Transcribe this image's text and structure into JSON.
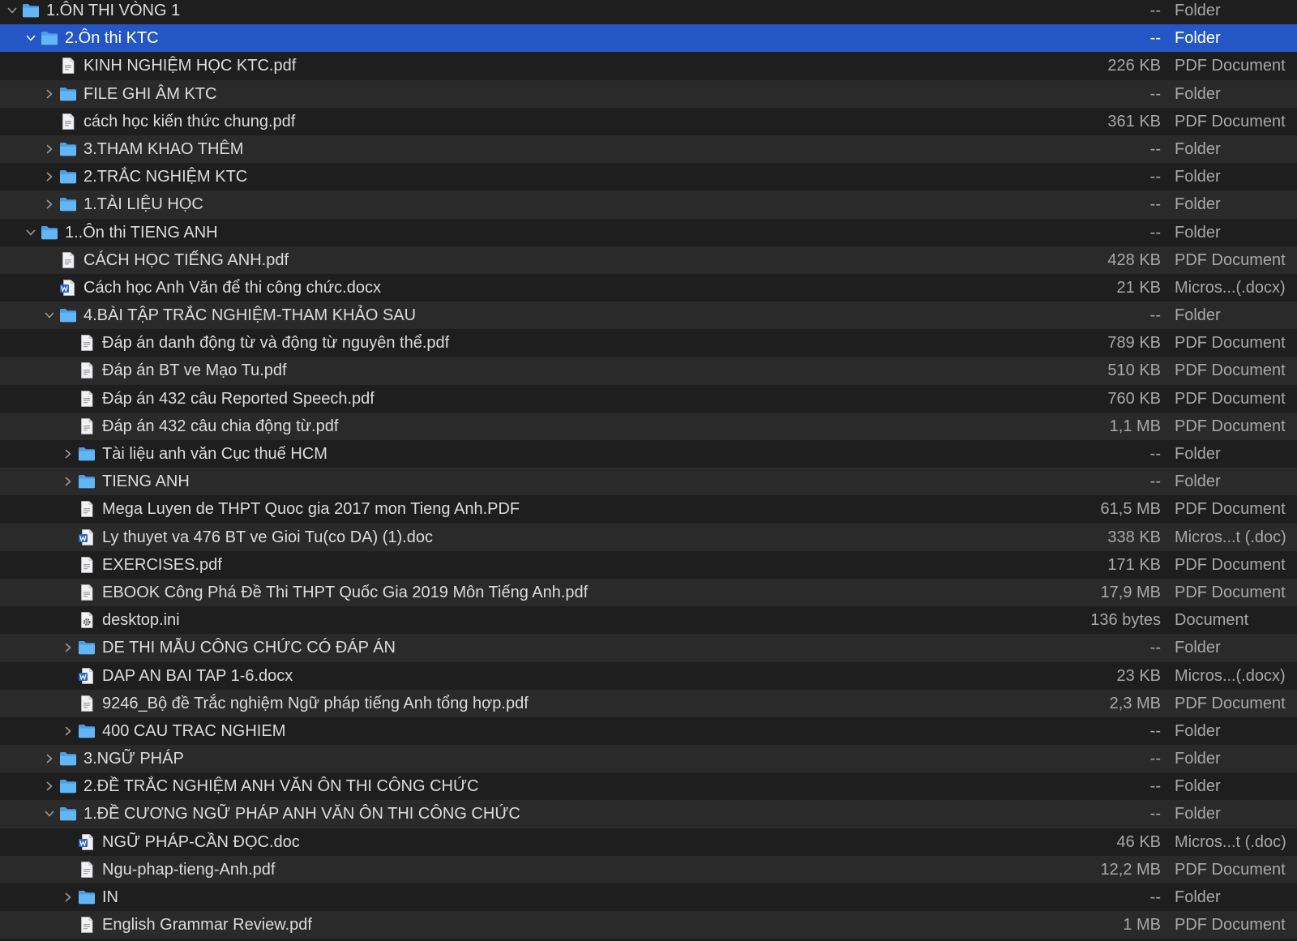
{
  "rows": [
    {
      "name": "1.ÔN THI VÒNG 1",
      "size": "--",
      "kind": "Folder",
      "depth": 0,
      "type": "folder",
      "disclosure": "expanded",
      "selected": false
    },
    {
      "name": "2.Ôn thi  KTC",
      "size": "--",
      "kind": "Folder",
      "depth": 1,
      "type": "folder",
      "disclosure": "expanded",
      "selected": true
    },
    {
      "name": "KINH NGHIỆM HỌC KTC.pdf",
      "size": "226 KB",
      "kind": "PDF Document",
      "depth": 2,
      "type": "pdf",
      "disclosure": "none",
      "selected": false
    },
    {
      "name": "FILE GHI ÂM KTC",
      "size": "--",
      "kind": "Folder",
      "depth": 2,
      "type": "folder",
      "disclosure": "collapsed",
      "selected": false
    },
    {
      "name": "cách học kiến thức chung.pdf",
      "size": "361 KB",
      "kind": "PDF Document",
      "depth": 2,
      "type": "pdf",
      "disclosure": "none",
      "selected": false
    },
    {
      "name": "3.THAM KHAO THÊM",
      "size": "--",
      "kind": "Folder",
      "depth": 2,
      "type": "folder",
      "disclosure": "collapsed",
      "selected": false
    },
    {
      "name": "2.TRẮC NGHIỆM KTC",
      "size": "--",
      "kind": "Folder",
      "depth": 2,
      "type": "folder",
      "disclosure": "collapsed",
      "selected": false
    },
    {
      "name": "1.TÀI LIỆU HỌC",
      "size": "--",
      "kind": "Folder",
      "depth": 2,
      "type": "folder",
      "disclosure": "collapsed",
      "selected": false
    },
    {
      "name": "1..Ôn thi TIENG ANH",
      "size": "--",
      "kind": "Folder",
      "depth": 1,
      "type": "folder",
      "disclosure": "expanded",
      "selected": false
    },
    {
      "name": "CÁCH HỌC TIẾNG ANH.pdf",
      "size": "428 KB",
      "kind": "PDF Document",
      "depth": 2,
      "type": "pdf",
      "disclosure": "none",
      "selected": false
    },
    {
      "name": "Cách học Anh Văn để thi công chức.docx",
      "size": "21 KB",
      "kind": "Micros...(.docx)",
      "depth": 2,
      "type": "word",
      "disclosure": "none",
      "selected": false
    },
    {
      "name": "4.BÀI TẬP TRẮC NGHIỆM-THAM KHẢO  SAU",
      "size": "--",
      "kind": "Folder",
      "depth": 2,
      "type": "folder",
      "disclosure": "expanded",
      "selected": false
    },
    {
      "name": "Đáp án danh động từ và động từ nguyên thể.pdf",
      "size": "789 KB",
      "kind": "PDF Document",
      "depth": 3,
      "type": "pdf",
      "disclosure": "none",
      "selected": false
    },
    {
      "name": "Đáp án BT ve Mạo Tu.pdf",
      "size": "510 KB",
      "kind": "PDF Document",
      "depth": 3,
      "type": "pdf",
      "disclosure": "none",
      "selected": false
    },
    {
      "name": "Đáp án 432 câu Reported Speech.pdf",
      "size": "760 KB",
      "kind": "PDF Document",
      "depth": 3,
      "type": "pdf",
      "disclosure": "none",
      "selected": false
    },
    {
      "name": "Đáp án 432 câu chia động từ.pdf",
      "size": "1,1 MB",
      "kind": "PDF Document",
      "depth": 3,
      "type": "pdf",
      "disclosure": "none",
      "selected": false
    },
    {
      "name": "Tài liệu anh văn Cục thuế HCM",
      "size": "--",
      "kind": "Folder",
      "depth": 3,
      "type": "folder",
      "disclosure": "collapsed",
      "selected": false
    },
    {
      "name": "TIENG ANH",
      "size": "--",
      "kind": "Folder",
      "depth": 3,
      "type": "folder",
      "disclosure": "collapsed",
      "selected": false
    },
    {
      "name": "Mega Luyen de THPT Quoc gia 2017 mon Tieng Anh.PDF",
      "size": "61,5 MB",
      "kind": "PDF Document",
      "depth": 3,
      "type": "pdf",
      "disclosure": "none",
      "selected": false
    },
    {
      "name": "Ly thuyet va 476 BT ve Gioi Tu(co DA) (1).doc",
      "size": "338 KB",
      "kind": "Micros...t (.doc)",
      "depth": 3,
      "type": "word",
      "disclosure": "none",
      "selected": false
    },
    {
      "name": "EXERCISES.pdf",
      "size": "171 KB",
      "kind": "PDF Document",
      "depth": 3,
      "type": "pdf",
      "disclosure": "none",
      "selected": false
    },
    {
      "name": "EBOOK Công Phá Đề Thi THPT Quốc Gia 2019 Môn Tiếng Anh.pdf",
      "size": "17,9 MB",
      "kind": "PDF Document",
      "depth": 3,
      "type": "pdf",
      "disclosure": "none",
      "selected": false
    },
    {
      "name": "desktop.ini",
      "size": "136 bytes",
      "kind": "Document",
      "depth": 3,
      "type": "ini",
      "disclosure": "none",
      "selected": false
    },
    {
      "name": "DE THI MẪU CÔNG CHỨC CÓ ĐÁP ÁN",
      "size": "--",
      "kind": "Folder",
      "depth": 3,
      "type": "folder",
      "disclosure": "collapsed",
      "selected": false
    },
    {
      "name": "DAP AN BAI TAP 1-6.docx",
      "size": "23 KB",
      "kind": "Micros...(.docx)",
      "depth": 3,
      "type": "word",
      "disclosure": "none",
      "selected": false
    },
    {
      "name": "9246_Bộ đề Trắc nghiệm Ngữ pháp tiếng Anh tổng hợp.pdf",
      "size": "2,3 MB",
      "kind": "PDF Document",
      "depth": 3,
      "type": "pdf",
      "disclosure": "none",
      "selected": false
    },
    {
      "name": "400 CAU TRAC NGHIEM",
      "size": "--",
      "kind": "Folder",
      "depth": 3,
      "type": "folder",
      "disclosure": "collapsed",
      "selected": false
    },
    {
      "name": "3.NGỮ PHÁP",
      "size": "--",
      "kind": "Folder",
      "depth": 2,
      "type": "folder",
      "disclosure": "collapsed",
      "selected": false
    },
    {
      "name": "2.ĐỀ TRẮC NGHIỆM ANH VĂN ÔN THI CÔNG CHỨC",
      "size": "--",
      "kind": "Folder",
      "depth": 2,
      "type": "folder",
      "disclosure": "collapsed",
      "selected": false
    },
    {
      "name": "1.ĐỀ CƯƠNG NGỮ PHÁP ANH VĂN ÔN THI CÔNG CHỨC",
      "size": "--",
      "kind": "Folder",
      "depth": 2,
      "type": "folder",
      "disclosure": "expanded",
      "selected": false
    },
    {
      "name": "NGỮ PHÁP-CẦN ĐỌC.doc",
      "size": "46 KB",
      "kind": "Micros...t (.doc)",
      "depth": 3,
      "type": "word",
      "disclosure": "none",
      "selected": false
    },
    {
      "name": "Ngu-phap-tieng-Anh.pdf",
      "size": "12,2 MB",
      "kind": "PDF Document",
      "depth": 3,
      "type": "pdf",
      "disclosure": "none",
      "selected": false
    },
    {
      "name": "IN",
      "size": "--",
      "kind": "Folder",
      "depth": 3,
      "type": "folder",
      "disclosure": "collapsed",
      "selected": false
    },
    {
      "name": "English Grammar Review.pdf",
      "size": "1 MB",
      "kind": "PDF Document",
      "depth": 3,
      "type": "pdf",
      "disclosure": "none",
      "selected": false
    }
  ],
  "colors": {
    "background": "#1e1e1e",
    "stripe": "#2a2a2a",
    "selection": "#2457c5",
    "folder": "#5aaef0",
    "secondary_text": "#a8a8a8"
  },
  "icon_names": {
    "folder": "folder-icon",
    "pdf": "pdf-document-icon",
    "word": "word-document-icon",
    "ini": "settings-document-icon",
    "expanded": "chevron-down-icon",
    "collapsed": "chevron-right-icon"
  }
}
